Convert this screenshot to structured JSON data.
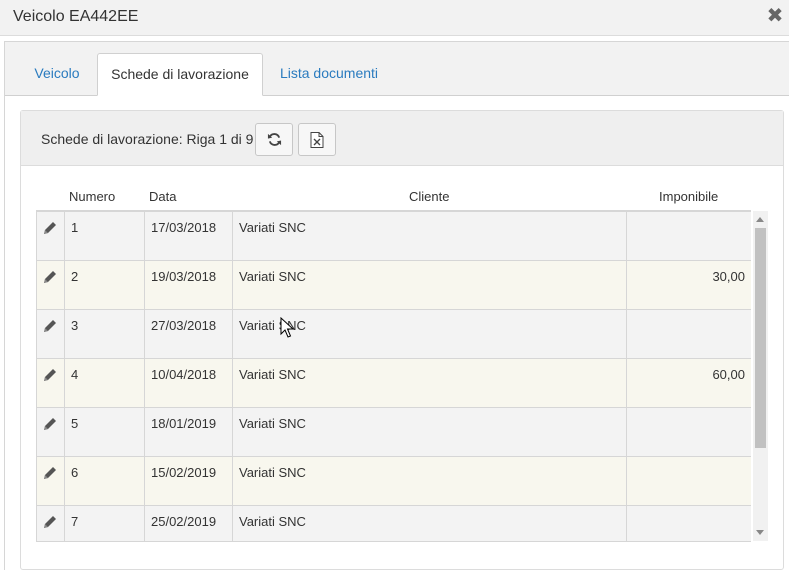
{
  "window": {
    "title": "Veicolo EA442EE",
    "close_glyph": "✖"
  },
  "tabs": [
    {
      "label": "Veicolo",
      "active": false
    },
    {
      "label": "Schede di lavorazione",
      "active": true
    },
    {
      "label": "Lista documenti",
      "active": false
    }
  ],
  "toolbar": {
    "label": "Schede di lavorazione: Riga 1 di 9",
    "refresh_icon": "refresh-icon",
    "excel_icon": "excel-export-icon"
  },
  "grid": {
    "columns": {
      "numero": "Numero",
      "data": "Data",
      "cliente": "Cliente",
      "imponibile": "Imponibile"
    },
    "rows": [
      {
        "numero": "1",
        "data": "17/03/2018",
        "cliente": "Variati SNC",
        "imponibile": ""
      },
      {
        "numero": "2",
        "data": "19/03/2018",
        "cliente": "Variati SNC",
        "imponibile": "30,00"
      },
      {
        "numero": "3",
        "data": "27/03/2018",
        "cliente": "Variati SNC",
        "imponibile": ""
      },
      {
        "numero": "4",
        "data": "10/04/2018",
        "cliente": "Variati SNC",
        "imponibile": "60,00"
      },
      {
        "numero": "5",
        "data": "18/01/2019",
        "cliente": "Variati SNC",
        "imponibile": ""
      },
      {
        "numero": "6",
        "data": "15/02/2019",
        "cliente": "Variati SNC",
        "imponibile": ""
      },
      {
        "numero": "7",
        "data": "25/02/2019",
        "cliente": "Variati SNC",
        "imponibile": ""
      }
    ]
  },
  "colors": {
    "accent_link": "#2a7bbf",
    "row_odd": "#f3f3f3",
    "row_even": "#f8f7ee"
  }
}
